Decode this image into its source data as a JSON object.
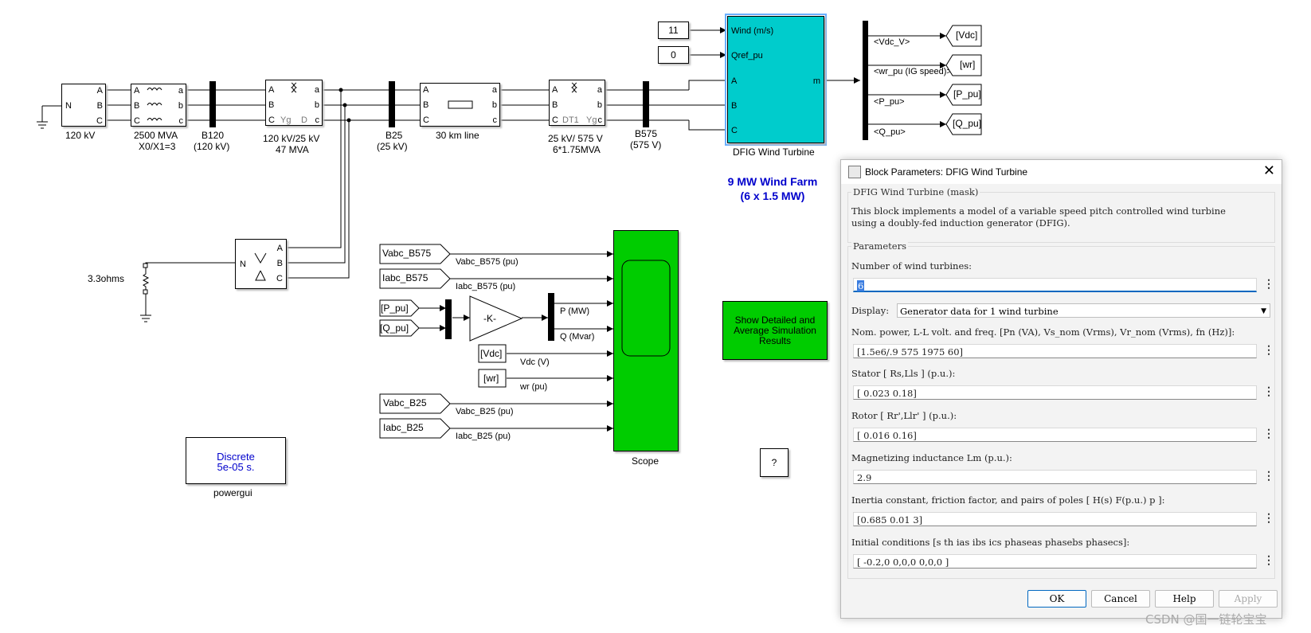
{
  "sources": {
    "v120_label": "120 kV"
  },
  "blocks": {
    "b2500_l1": "2500 MVA",
    "b2500_l2": "X0/X1=3",
    "b120_l1": "B120",
    "b120_l2": "(120 kV)",
    "tr1_l1": "120 kV/25 kV",
    "tr1_l2": "47 MVA",
    "b25_l1": "B25",
    "b25_l2": "(25 kV)",
    "line_label": "30 km line",
    "tr2_l1": "25 kV/ 575 V",
    "tr2_l2": "6*1.75MVA",
    "b575_l1": "B575",
    "b575_l2": "(575 V)",
    "ground_res": "3.3ohms",
    "dfig_label": "DFIG Wind Turbine",
    "farm_title_l1": "9 MW Wind Farm",
    "farm_title_l2": "(6 x 1.5 MW)",
    "wind_const": "11",
    "qref_const": "0",
    "wind_port": "Wind (m/s)",
    "qref_port": "Qref_pu",
    "port_a": "A",
    "port_b": "B",
    "port_c": "C",
    "port_m": "m",
    "gain_label": "-K-",
    "scope_label": "Scope",
    "powergui_l1": "Discrete",
    "powergui_l2": "5e-05 s.",
    "powergui_label": "powergui",
    "show_button_text": "Show Detailed and Average Simulation Results",
    "help_q": "?"
  },
  "bus_out": [
    "<Vdc_V>",
    "<wr_pu (IG speed)>",
    "<P_pu>",
    "<Q_pu>"
  ],
  "goto_tags": [
    "[Vdc]",
    "[wr]",
    "[P_pu]",
    "[Q_pu]"
  ],
  "from_tags": [
    "Vabc_B575",
    "Iabc_B575",
    "[P_pu]",
    "[Q_pu]",
    "[Vdc]",
    "[wr]",
    "Vabc_B25",
    "Iabc_B25"
  ],
  "scope_signals": [
    "Vabc_B575 (pu)",
    "Iabc_B575 (pu)",
    "P (MW)",
    "Q (Mvar)",
    "Vdc (V)",
    "wr (pu)",
    "Vabc_B25 (pu)",
    "Iabc_B25 (pu)"
  ],
  "dialog": {
    "title": "Block Parameters: DFIG Wind Turbine",
    "mask_group": "DFIG Wind Turbine (mask)",
    "description_l1": "This block implements a  model of a variable speed pitch controlled wind turbine",
    "description_l2": "using a doubly-fed induction generator (DFIG).",
    "params_group": "Parameters",
    "num_turbines_label": "Number of wind turbines:",
    "num_turbines_value": "6",
    "display_label": "Display:",
    "display_value": "Generator data for 1 wind turbine",
    "nom_label": "Nom. power, L-L volt. and freq. [Pn (VA), Vs_nom (Vrms), Vr_nom (Vrms), fn (Hz)]:",
    "nom_value": "[1.5e6/.9 575 1975 60]",
    "stator_label": "Stator [ Rs,Lls ] (p.u.):",
    "stator_value": "[ 0.023  0.18]",
    "rotor_label": "Rotor [ Rr',Llr' ] (p.u.):",
    "rotor_value": "[ 0.016  0.16]",
    "lm_label": "Magnetizing inductance Lm (p.u.):",
    "lm_value": "2.9",
    "inertia_label": "Inertia constant, friction factor, and pairs of poles [ H(s)  F(p.u.)  p ]:",
    "inertia_value": "[0.685 0.01 3]",
    "init_label": "Initial conditions [s  th  ias  ibs  ics  phaseas phasebs phasecs]:",
    "init_value": "[ -0.2,0   0,0,0   0,0,0 ]",
    "ok": "OK",
    "cancel": "Cancel",
    "help": "Help",
    "apply": "Apply"
  },
  "watermark": "CSDN @国一链轮宝宝",
  "colors": {
    "turbine": "#00cccc",
    "scope": "#00cc00",
    "farm_title": "#0000cc",
    "selection": "#6ab0ff",
    "annotation": "#e8141a"
  }
}
